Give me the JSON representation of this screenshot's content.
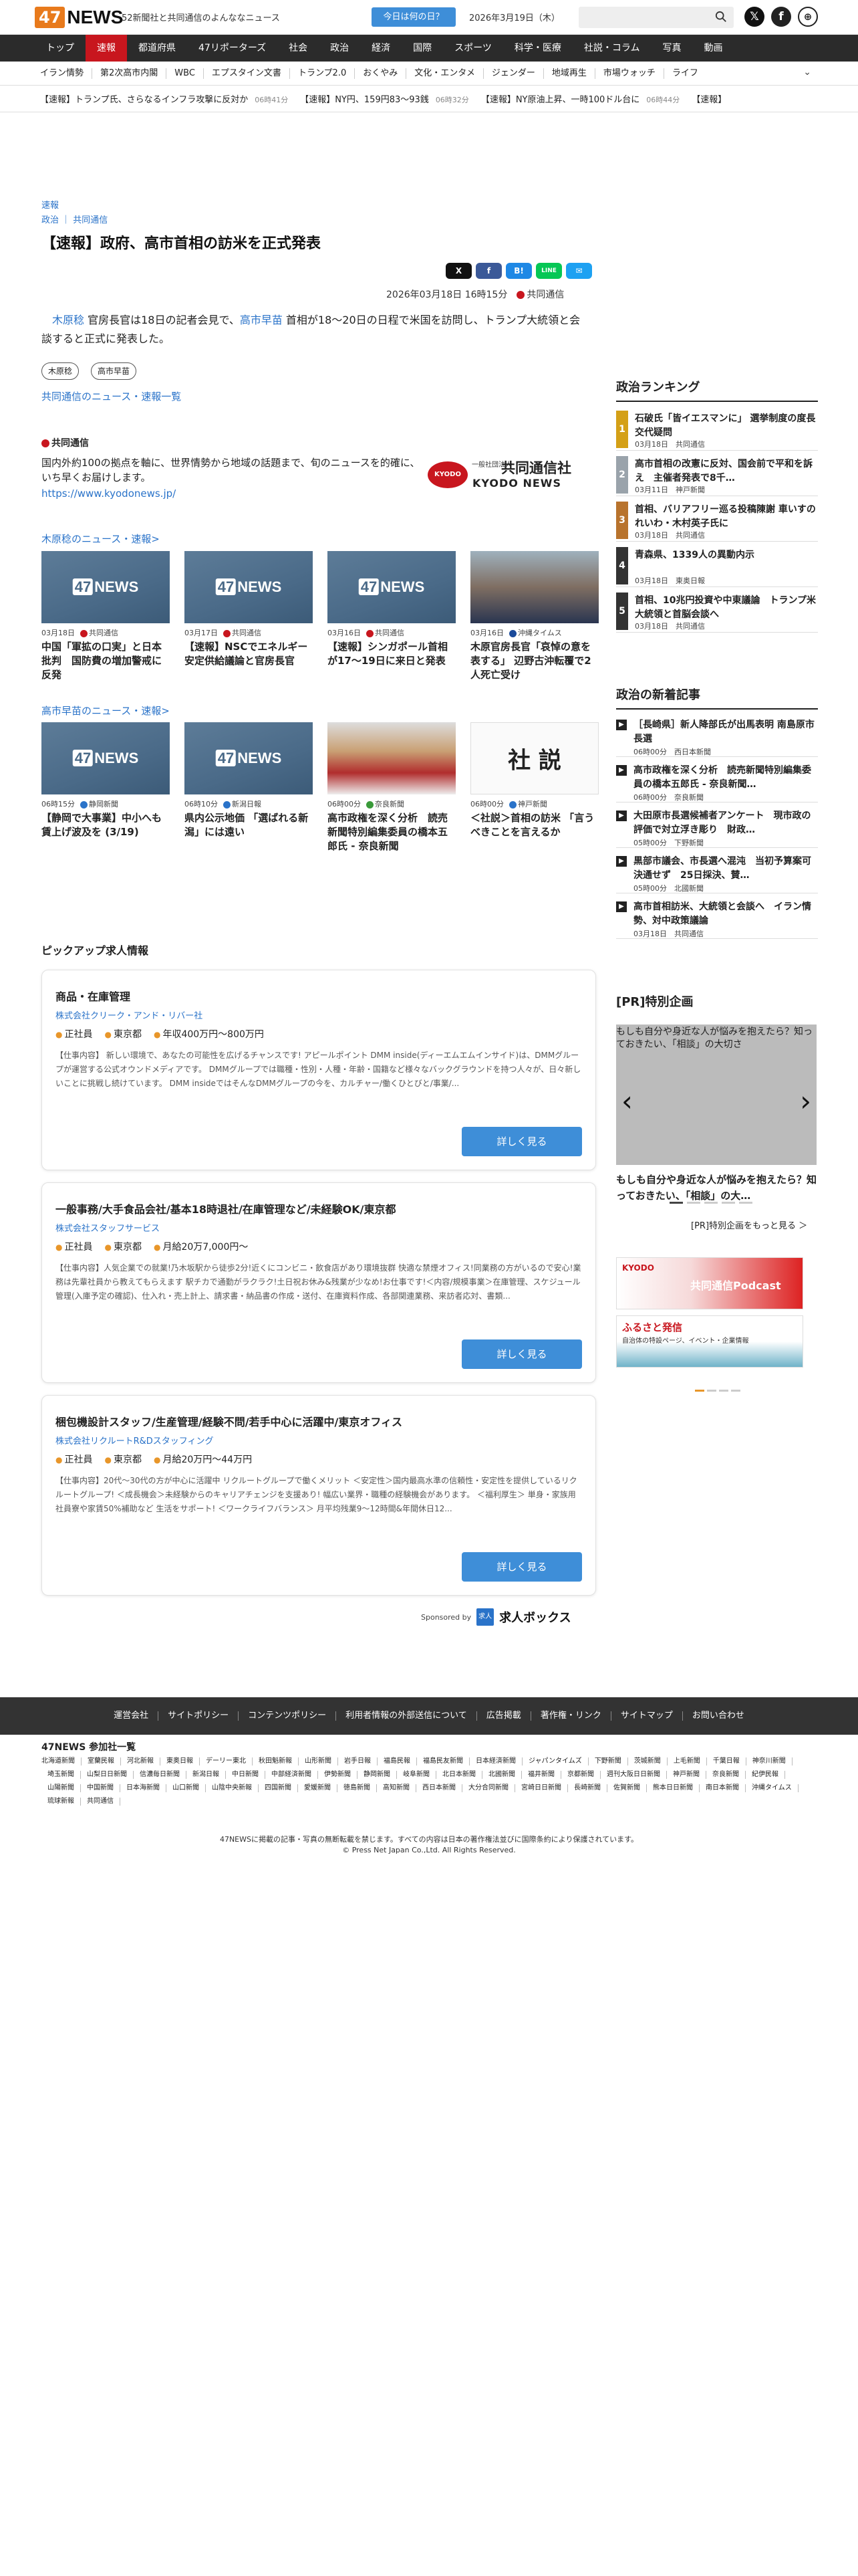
{
  "header": {
    "tagline": "52新聞社と共同通信のよんななニュース",
    "today_button": "今日は何の日？",
    "date": "2026年3月19日（木）",
    "logo_num": "47",
    "logo_word": "NEWS"
  },
  "nav": [
    "トップ",
    "速報",
    "都道府県",
    "47リポーターズ",
    "社会",
    "政治",
    "経済",
    "国際",
    "スポーツ",
    "科学・医療",
    "社説・コラム",
    "写真",
    "動画"
  ],
  "subnav": [
    "イラン情勢",
    "第2次高市内閣",
    "WBC",
    "エプスタイン文書",
    "トランプ2.0",
    "おくやみ",
    "文化・エンタメ",
    "ジェンダー",
    "地域再生",
    "市場ウォッチ",
    "ライフ"
  ],
  "ticker": [
    {
      "t": "【速報】トランプ氏、さらなるインフラ攻撃に反対か",
      "time": "06時41分"
    },
    {
      "t": "【速報】NY円、159円83〜93銭",
      "time": "06時32分"
    },
    {
      "t": "【速報】NY原油上昇、一時100ドル台に",
      "time": "06時44分"
    },
    {
      "t": "【速報】",
      "time": ""
    }
  ],
  "article": {
    "crumb1": "速報",
    "crumb2": "政治 ｜ 共同通信",
    "title": "【速報】政府、高市首相の訪米を正式発表",
    "meta_date": "2026年03月18日 16時15分",
    "meta_src": "共同通信",
    "body_a": "木原稔",
    "body_b": " 官房長官は18日の記者会見で、",
    "body_c": "高市早苗",
    "body_d": " 首相が18〜20日の日程で米国を訪問し、トランプ大統領と会談すると正式に発表した。",
    "tags": [
      "木原稔",
      "高市早苗"
    ],
    "more_link": "共同通信のニュース・速報一覧",
    "share": [
      "X",
      "f",
      "B!",
      "LINE",
      "✉"
    ]
  },
  "source": {
    "name": "共同通信",
    "desc": "国内外約100の拠点を軸に、世界情勢から地域の話題まで、旬のニュースを的確に、いち早くお届けします。",
    "url": "https://www.kyodonews.jp/",
    "banner_small": "一般社団法人",
    "banner_name": "共同通信社",
    "banner_en": "KYODO NEWS",
    "banner_logo": "KYODO"
  },
  "sec1": {
    "title": "木原稔のニュース・速報>",
    "cards": [
      {
        "date": "03月18日",
        "src": "共同通信",
        "title": "中国「軍拡の口実」と日本批判　国防費の増加警戒に反発"
      },
      {
        "date": "03月17日",
        "src": "共同通信",
        "title": "【速報】NSCでエネルギー安定供給議論と官房長官"
      },
      {
        "date": "03月16日",
        "src": "共同通信",
        "title": "【速報】シンガポール首相が17〜19日に来日と発表"
      },
      {
        "date": "03月16日",
        "src": "沖縄タイムス",
        "title": "木原官房長官「哀悼の意を表する」 辺野古沖転覆で2人死亡受け"
      }
    ]
  },
  "sec2": {
    "title": "高市早苗のニュース・速報>",
    "cards": [
      {
        "date": "06時15分",
        "src": "静岡新聞",
        "title": "【静岡で大事業】中小へも賃上げ波及を (3/19)"
      },
      {
        "date": "06時10分",
        "src": "新潟日報",
        "title": "県内公示地価 「選ばれる新潟」には遠い"
      },
      {
        "date": "06時00分",
        "src": "奈良新聞",
        "title": "高市政権を深く分析　読売新聞特別編集委員の橋本五郎氏 - 奈良新聞"
      },
      {
        "date": "06時00分",
        "src": "神戸新聞",
        "title": "＜社説＞首相の訪米 「言うべきことを言えるか"
      }
    ]
  },
  "thumb": {
    "num": "47",
    "word": "NEWS",
    "editorial": "社 説"
  },
  "jobs_title": "ピックアップ求人情報",
  "jobs": [
    {
      "title": "商品・在庫管理",
      "company": "株式会社クリーク・アンド・リバー社",
      "type": "正社員",
      "loc": "東京都",
      "pay": "年収400万円〜800万円",
      "desc": "【仕事内容】 新しい環境で、あなたの可能性を広げるチャンスです! アピールポイント DMM inside(ディーエムエムインサイド)は、DMMグループが運営する公式オウンドメディアです。 DMMグループでは職種・性別・人種・年齢・国籍など様々なバックグラウンドを持つ人々が、日々新しいことに挑戦し続けています。 DMM insideではそんなDMMグループの今を、カルチャー/働くひとびと/事業/...",
      "btn": "詳しく見る"
    },
    {
      "title": "一般事務/大手食品会社/基本18時退社/在庫管理など/未経験OK/東京都",
      "company": "株式会社スタッフサービス",
      "type": "正社員",
      "loc": "東京都",
      "pay": "月給20万7,000円〜",
      "desc": "【仕事内容】人気企業での就業!乃木坂駅から徒歩2分!近くにコンビニ・飲食店があり環境抜群 快適な禁煙オフィス!同業務の方がいるので安心!業務は先輩社員から教えてもらえます 駅チカで通勤がラクラク!土日祝お休み&残業が少なめ!お仕事です!＜内容/規模事業＞在庫管理、スケジュール管理(入庫予定の確認)、仕入れ・売上計上、請求書・納品書の作成・送付、在庫資料作成、各部関連業務、来訪者応対、書類...",
      "btn": "詳しく見る"
    },
    {
      "title": "梱包機設計スタッフ/生産管理/経験不問/若手中心に活躍中/東京オフィス",
      "company": "株式会社リクルートR&Dスタッフィング",
      "type": "正社員",
      "loc": "東京都",
      "pay": "月給20万円〜44万円",
      "desc": "【仕事内容】20代〜30代の方が中心に活躍中 リクルートグループで働くメリット ＜安定性＞国内最高水準の信頼性・安定性を提供しているリクルートグループ! ＜成長機会＞未経験からのキャリアチェンジを支援あり! 幅広い業界・職種の経験機会があります。 ＜福利厚生＞ 単身・家族用社員寮や家賃50%補助など 生活をサポート! ＜ワークライフバランス＞ 月平均残業9〜12時間&年間休日12...",
      "btn": "詳しく見る"
    }
  ],
  "sponsor": {
    "label": "Sponsored by",
    "name": "求人ボックス",
    "box": "求人"
  },
  "ranking": {
    "title": "政治ランキング",
    "items": [
      {
        "n": "1",
        "t": "石破氏「皆イエスマンに」 選挙制度の度長交代疑問",
        "date": "03月18日",
        "src": "共同通信"
      },
      {
        "n": "2",
        "t": "高市首相の改憲に反対、国会前で平和を訴え　主催者発表で8千…",
        "date": "03月11日",
        "src": "神戸新聞"
      },
      {
        "n": "3",
        "t": "首相、バリアフリー巡る投稿陳謝 車いすのれいわ・木村英子氏に",
        "date": "03月18日",
        "src": "共同通信"
      },
      {
        "n": "4",
        "t": "青森県、1339人の異動内示",
        "date": "03月18日",
        "src": "東奥日報"
      },
      {
        "n": "5",
        "t": "首相、10兆円投資や中東議論　トランプ米大統領と首脳会談へ",
        "date": "03月18日",
        "src": "共同通信"
      }
    ]
  },
  "newpol": {
    "title": "政治の新着記事",
    "items": [
      {
        "t": "［長崎県］新人降部氏が出馬表明 南島原市長選",
        "date": "06時00分",
        "src": "西日本新聞"
      },
      {
        "t": "高市政権を深く分析　読売新聞特別編集委員の橋本五郎氏 - 奈良新聞…",
        "date": "06時00分",
        "src": "奈良新聞"
      },
      {
        "t": "大田原市長選候補者アンケート　現市政の評価で対立浮き彫り　財政…",
        "date": "05時00分",
        "src": "下野新聞"
      },
      {
        "t": "黒部市議会、市長選へ混沌　当初予算案可決通せず　25日採決、賛…",
        "date": "05時00分",
        "src": "北國新聞"
      },
      {
        "t": "高市首相訪米、大統領と会談へ　イラン情勢、対中政策議論",
        "date": "03月18日",
        "src": "共同通信"
      }
    ]
  },
  "pr": {
    "title": "[PR]特別企画",
    "img_alt": "もしも自分や身近な人が悩みを抱えたら？知っておきたい、「相談」の大切さ",
    "caption": "もしも自分や身近な人が悩みを抱えたら？知っておきたい、「相談」の大…",
    "more": "[PR]特別企画をもっと見る ＞"
  },
  "banners": {
    "b1_top": "KYODO",
    "b1_main": "共同通信Podcast",
    "b2_main": "ふるさと発信",
    "b2_sub": "自治体の特設ページ、イベント・企業情報"
  },
  "footer": {
    "links": [
      "運営会社",
      "サイトポリシー",
      "コンテンツポリシー",
      "利用者情報の外部送信について",
      "広告掲載",
      "著作権・リンク",
      "サイトマップ",
      "お問い合わせ"
    ],
    "papers_title": "47NEWS 参加社一覧",
    "papers": [
      "北海道新聞",
      "室蘭民報",
      "河北新報",
      "東奥日報",
      "デーリー東北",
      "秋田魁新報",
      "山形新聞",
      "岩手日報",
      "福島民報",
      "福島民友新聞",
      "日本経済新聞",
      "ジャパンタイムズ",
      "下野新聞",
      "茨城新聞",
      "上毛新聞",
      "千葉日報",
      "神奈川新聞",
      "埼玉新聞",
      "山梨日日新聞",
      "信濃毎日新聞",
      "新潟日報",
      "中日新聞",
      "中部経済新聞",
      "伊勢新聞",
      "静岡新聞",
      "岐阜新聞",
      "北日本新聞",
      "北國新聞",
      "福井新聞",
      "京都新聞",
      "週刊大阪日日新聞",
      "神戸新聞",
      "奈良新聞",
      "紀伊民報",
      "山陽新聞",
      "中国新聞",
      "日本海新聞",
      "山口新聞",
      "山陰中央新報",
      "四国新聞",
      "愛媛新聞",
      "徳島新聞",
      "高知新聞",
      "西日本新聞",
      "大分合同新聞",
      "宮崎日日新聞",
      "長崎新聞",
      "佐賀新聞",
      "熊本日日新聞",
      "南日本新聞",
      "沖縄タイムス",
      "琉球新報",
      "共同通信"
    ],
    "copy1": "47NEWSに掲載の記事・写真の無断転載を禁じます。すべての内容は日本の著作権法並びに国際条約により保護されています。",
    "copy2": "© Press Net Japan Co.,Ltd. All Rights Reserved."
  }
}
